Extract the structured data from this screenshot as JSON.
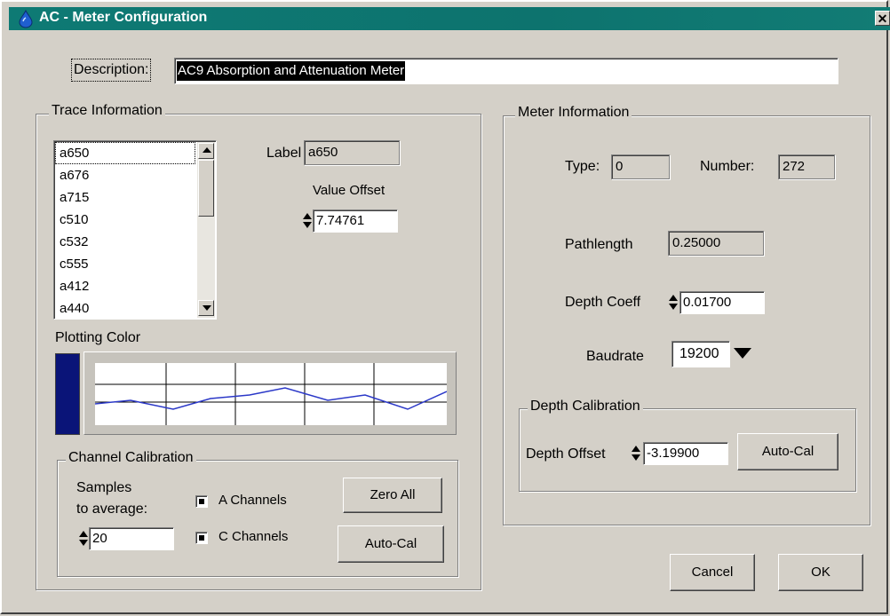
{
  "window": {
    "title": "AC - Meter Configuration",
    "close_glyph": "✕"
  },
  "description": {
    "label": "Description:",
    "value": "AC9 Absorption and Attenuation Meter"
  },
  "trace": {
    "title": "Trace Information",
    "list": [
      "a650",
      "a676",
      "a715",
      "c510",
      "c532",
      "c555",
      "a412",
      "a440"
    ],
    "label_caption": "Label",
    "label_value": "a650",
    "value_offset_caption": "Value Offset",
    "value_offset": "7.74761",
    "plotting_color_caption": "Plotting Color",
    "plot_color": "#0a1478",
    "trace_line_color": "#2b38c8"
  },
  "channel_calibration": {
    "title": "Channel Calibration",
    "samples_line1": "Samples",
    "samples_line2": "to average:",
    "samples_value": "20",
    "a_channels": "A Channels",
    "c_channels": "C Channels",
    "a_checked": true,
    "c_checked": true,
    "zero_all": "Zero All",
    "auto_cal": "Auto-Cal"
  },
  "meter": {
    "title": "Meter Information",
    "type_label": "Type:",
    "type_value": "0",
    "number_label": "Number:",
    "number_value": "272",
    "pathlength_label": "Pathlength",
    "pathlength_value": "0.25000",
    "depth_coeff_label": "Depth Coeff",
    "depth_coeff_value": "0.01700",
    "baudrate_label": "Baudrate",
    "baudrate_value": "19200"
  },
  "depth_calibration": {
    "title": "Depth Calibration",
    "offset_label": "Depth Offset",
    "offset_value": "-3.19900",
    "auto_cal": "Auto-Cal"
  },
  "buttons": {
    "cancel": "Cancel",
    "ok": "OK"
  },
  "icons": {
    "app": "water-drop-icon",
    "spin": "spin-arrows-icon",
    "dropdown": "dropdown-arrow-icon"
  }
}
